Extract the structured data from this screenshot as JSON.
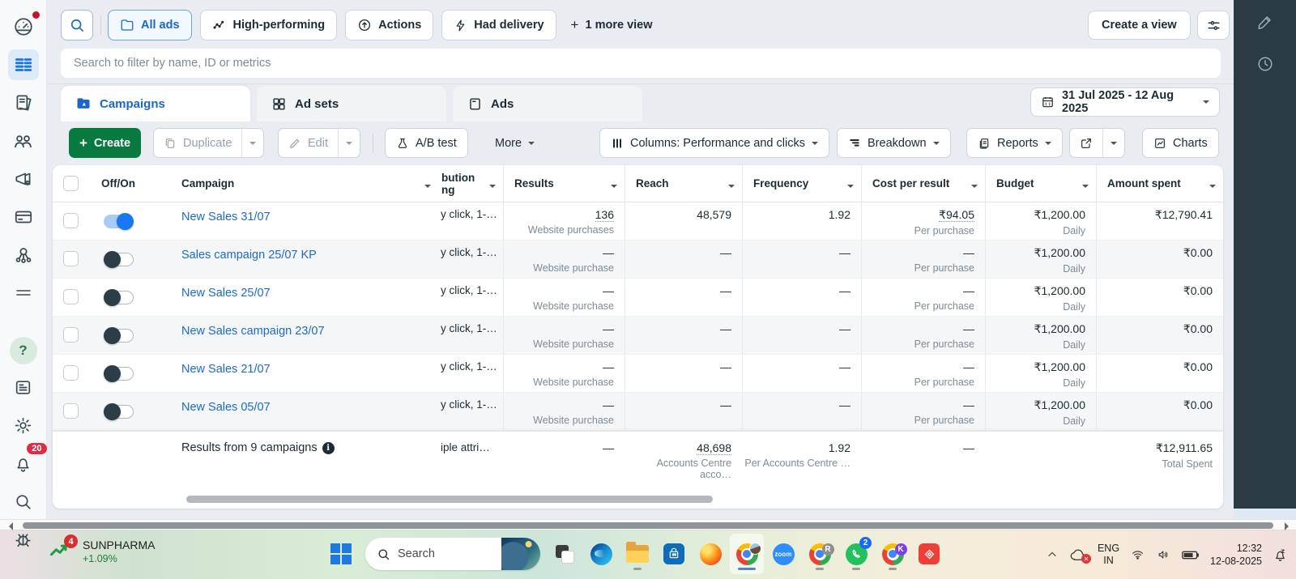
{
  "views": {
    "tabs": [
      {
        "label": "All ads",
        "active": true
      },
      {
        "label": "High-performing",
        "active": false
      },
      {
        "label": "Actions",
        "active": false
      },
      {
        "label": "Had delivery",
        "active": false
      }
    ],
    "more_view": "1 more view",
    "create_view": "Create a view"
  },
  "filter": {
    "placeholder": "Search to filter by name, ID or metrics"
  },
  "levels": [
    {
      "label": "Campaigns",
      "active": true
    },
    {
      "label": "Ad sets",
      "active": false
    },
    {
      "label": "Ads",
      "active": false
    }
  ],
  "date_range": "31 Jul 2025 - 12 Aug 2025",
  "toolbar": {
    "create": "Create",
    "duplicate": "Duplicate",
    "edit": "Edit",
    "ab_test": "A/B test",
    "more": "More",
    "columns": "Columns: Performance and clicks",
    "breakdown": "Breakdown",
    "reports": "Reports",
    "charts": "Charts"
  },
  "table": {
    "headers": {
      "off_on": "Off/On",
      "campaign": "Campaign",
      "attribution_line1": "bution",
      "attribution_line2": "ng",
      "results": "Results",
      "reach": "Reach",
      "frequency": "Frequency",
      "cost": "Cost per result",
      "budget": "Budget",
      "spent": "Amount spent"
    },
    "rows": [
      {
        "name": "New Sales 31/07",
        "on": true,
        "attribution": "y click, 1-…",
        "results": "136",
        "results_link": true,
        "results_sub": "Website purchases",
        "reach": "48,579",
        "frequency": "1.92",
        "cost": "₹94.05",
        "cost_link": true,
        "cost_sub": "Per purchase",
        "budget": "₹1,200.00",
        "budget_sub": "Daily",
        "spent": "₹12,790.41"
      },
      {
        "name": "Sales campaign 25/07 KP",
        "on": false,
        "attribution": "y click, 1-…",
        "results": "—",
        "results_sub": "Website purchase",
        "reach": "—",
        "frequency": "—",
        "cost": "—",
        "cost_sub": "Per purchase",
        "budget": "₹1,200.00",
        "budget_sub": "Daily",
        "spent": "₹0.00"
      },
      {
        "name": "New Sales 25/07",
        "on": false,
        "attribution": "y click, 1-…",
        "results": "—",
        "results_sub": "Website purchase",
        "reach": "—",
        "frequency": "—",
        "cost": "—",
        "cost_sub": "Per purchase",
        "budget": "₹1,200.00",
        "budget_sub": "Daily",
        "spent": "₹0.00"
      },
      {
        "name": "New Sales campaign 23/07",
        "on": false,
        "attribution": "y click, 1-…",
        "results": "—",
        "results_sub": "Website purchase",
        "reach": "—",
        "frequency": "—",
        "cost": "—",
        "cost_sub": "Per purchase",
        "budget": "₹1,200.00",
        "budget_sub": "Daily",
        "spent": "₹0.00"
      },
      {
        "name": "New Sales 21/07",
        "on": false,
        "attribution": "y click, 1-…",
        "results": "—",
        "results_sub": "Website purchase",
        "reach": "—",
        "frequency": "—",
        "cost": "—",
        "cost_sub": "Per purchase",
        "budget": "₹1,200.00",
        "budget_sub": "Daily",
        "spent": "₹0.00"
      },
      {
        "name": "New Sales 05/07",
        "on": false,
        "attribution": "y click, 1-…",
        "results": "—",
        "results_sub": "Website purchase",
        "reach": "—",
        "frequency": "—",
        "cost": "—",
        "cost_sub": "Per purchase",
        "budget": "₹1,200.00",
        "budget_sub": "Daily",
        "spent": "₹0.00"
      }
    ],
    "summary": {
      "label": "Results from 9 campaigns",
      "attribution": "iple attri…",
      "results": "—",
      "reach": "48,698",
      "reach_sub": "Accounts Centre acco…",
      "frequency": "1.92",
      "frequency_sub": "Per Accounts Centre …",
      "cost": "—",
      "spent": "₹12,911.65",
      "spent_sub": "Total Spent"
    }
  },
  "sidebar": {
    "notifications_badge": "20"
  },
  "taskbar": {
    "stock": {
      "badge": "4",
      "symbol": "SUNPHARMA",
      "change": "+1.09%"
    },
    "search_label": "Search",
    "zoom_label": "zoom",
    "chrome_r_badge": "R",
    "chrome_k_badge": "K",
    "whatsapp_badge": "2",
    "tray": {
      "lang_top": "ENG",
      "lang_bottom": "IN",
      "time": "12:32",
      "date": "12-08-2025"
    }
  }
}
